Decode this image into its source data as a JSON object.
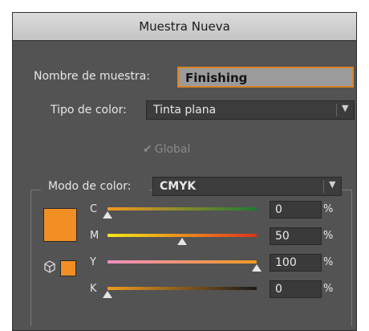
{
  "dialog": {
    "title": "Muestra Nueva",
    "name_label": "Nombre de muestra:",
    "name_value": "Finishing",
    "color_type_label": "Tipo de color:",
    "color_type_value": "Tinta plana",
    "global_label": "Global",
    "global_checked": true,
    "color_mode_label": "Modo de color:",
    "color_mode_value": "CMYK",
    "swatch_color": "#f18f24",
    "percent_unit": "%",
    "channels": [
      {
        "label": "C",
        "value": "0",
        "fraction": 0.0,
        "gradient": [
          "#f39a22",
          "#1e7a32"
        ]
      },
      {
        "label": "M",
        "value": "50",
        "fraction": 0.5,
        "gradient": [
          "#f4e81a",
          "#e0331e"
        ]
      },
      {
        "label": "Y",
        "value": "100",
        "fraction": 1.0,
        "gradient": [
          "#ee8fc0",
          "#f39a22"
        ]
      },
      {
        "label": "K",
        "value": "0",
        "fraction": 0.0,
        "gradient": [
          "#f39a22",
          "#1a1a1a"
        ]
      }
    ]
  }
}
